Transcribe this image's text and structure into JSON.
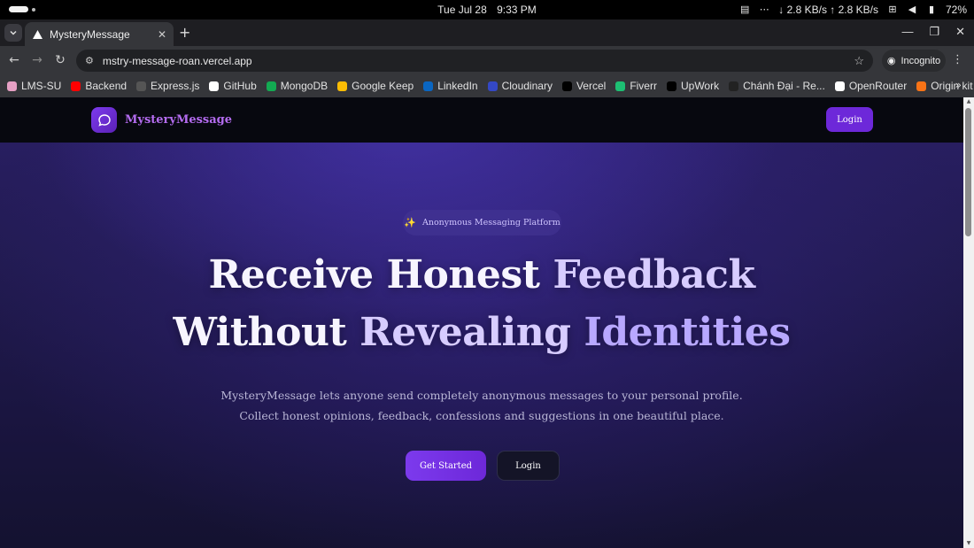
{
  "os": {
    "date": "Tue Jul 28",
    "time": "9:33 PM",
    "network_speed": "↓ 2.8 KB/s ↑ 2.8 KB/s",
    "battery": "72%",
    "icons": [
      "clipboard-icon",
      "ellipsis-icon",
      "network-icon",
      "volume-icon",
      "battery-icon"
    ]
  },
  "browser": {
    "tab": {
      "title": "MysteryMessage",
      "favicon": "vercel-triangle-icon"
    },
    "url": "mstry-message-roan.vercel.app",
    "incognito_label": "Incognito",
    "bookmarks": [
      {
        "label": "LMS-SU",
        "color": "#e6a0c4"
      },
      {
        "label": "Backend",
        "color": "#ff0000"
      },
      {
        "label": "Express.js",
        "color": "#555555"
      },
      {
        "label": "GitHub",
        "color": "#ffffff"
      },
      {
        "label": "MongoDB",
        "color": "#13aa52"
      },
      {
        "label": "Google Keep",
        "color": "#fbbc04"
      },
      {
        "label": "LinkedIn",
        "color": "#0a66c2"
      },
      {
        "label": "Cloudinary",
        "color": "#3448c5"
      },
      {
        "label": "Vercel",
        "color": "#000000"
      },
      {
        "label": "Fiverr",
        "color": "#1dbf73"
      },
      {
        "label": "UpWork",
        "color": "#000000"
      },
      {
        "label": "Chánh Đại - Re...",
        "color": "#222222"
      },
      {
        "label": "OpenRouter",
        "color": "#ffffff"
      },
      {
        "label": "Origin kit",
        "color": "#f97316"
      }
    ]
  },
  "site": {
    "brand": "MysteryMessage",
    "nav_login": "Login",
    "badge": "Anonymous Messaging Platform",
    "headline": {
      "line1_part1": "Receive Honest",
      "line1_part2": "Feedback",
      "line2_part1": "Without",
      "line2_part2": "Revealing",
      "line2_part3": "Identities"
    },
    "subtitle": {
      "line1": "MysteryMessage lets anyone send completely anonymous messages to your personal profile.",
      "line2": "Collect honest opinions, feedback, confessions and suggestions in one beautiful place."
    },
    "cta_primary": "Get Started",
    "cta_secondary": "Login"
  },
  "colors": {
    "accent": "#6d28d9",
    "brand_text": "#b46cf0"
  }
}
